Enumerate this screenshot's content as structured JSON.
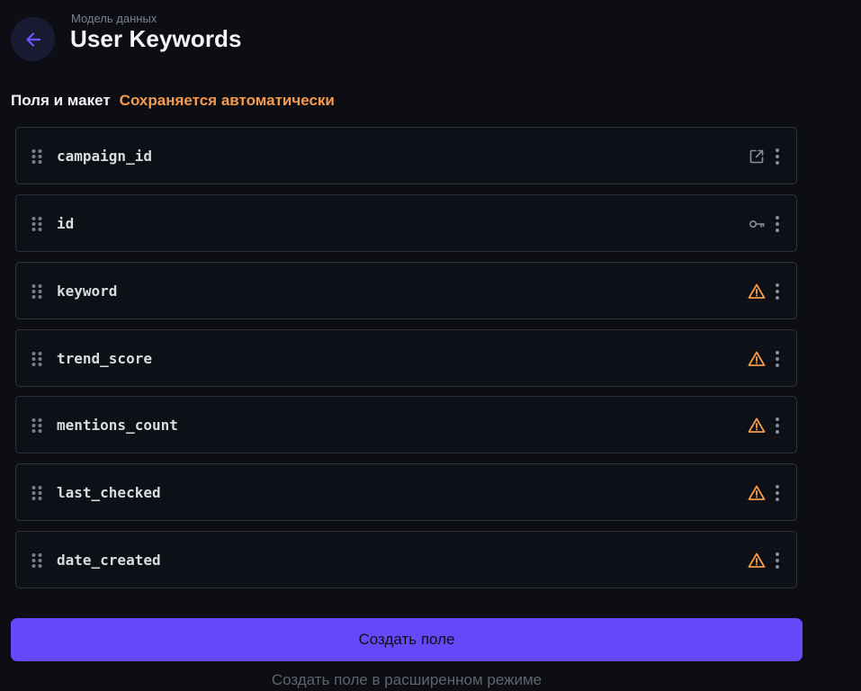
{
  "header": {
    "eyebrow": "Модель данных",
    "title": "User Keywords",
    "back_icon": "arrow-left-icon"
  },
  "section": {
    "label": "Поля и макет",
    "autosave": "Сохраняется автоматически"
  },
  "fields": [
    {
      "name": "campaign_id",
      "status_icon": "external-link-icon"
    },
    {
      "name": "id",
      "status_icon": "key-icon"
    },
    {
      "name": "keyword",
      "status_icon": "warning-icon"
    },
    {
      "name": "trend_score",
      "status_icon": "warning-icon"
    },
    {
      "name": "mentions_count",
      "status_icon": "warning-icon"
    },
    {
      "name": "last_checked",
      "status_icon": "warning-icon"
    },
    {
      "name": "date_created",
      "status_icon": "warning-icon"
    }
  ],
  "actions": {
    "create_label": "Создать поле",
    "advanced_label": "Создать поле в расширенном режиме"
  },
  "colors": {
    "accent": "#6548f8",
    "warning": "#f59a4a",
    "background": "#0c0e14",
    "border": "#2f323b"
  }
}
